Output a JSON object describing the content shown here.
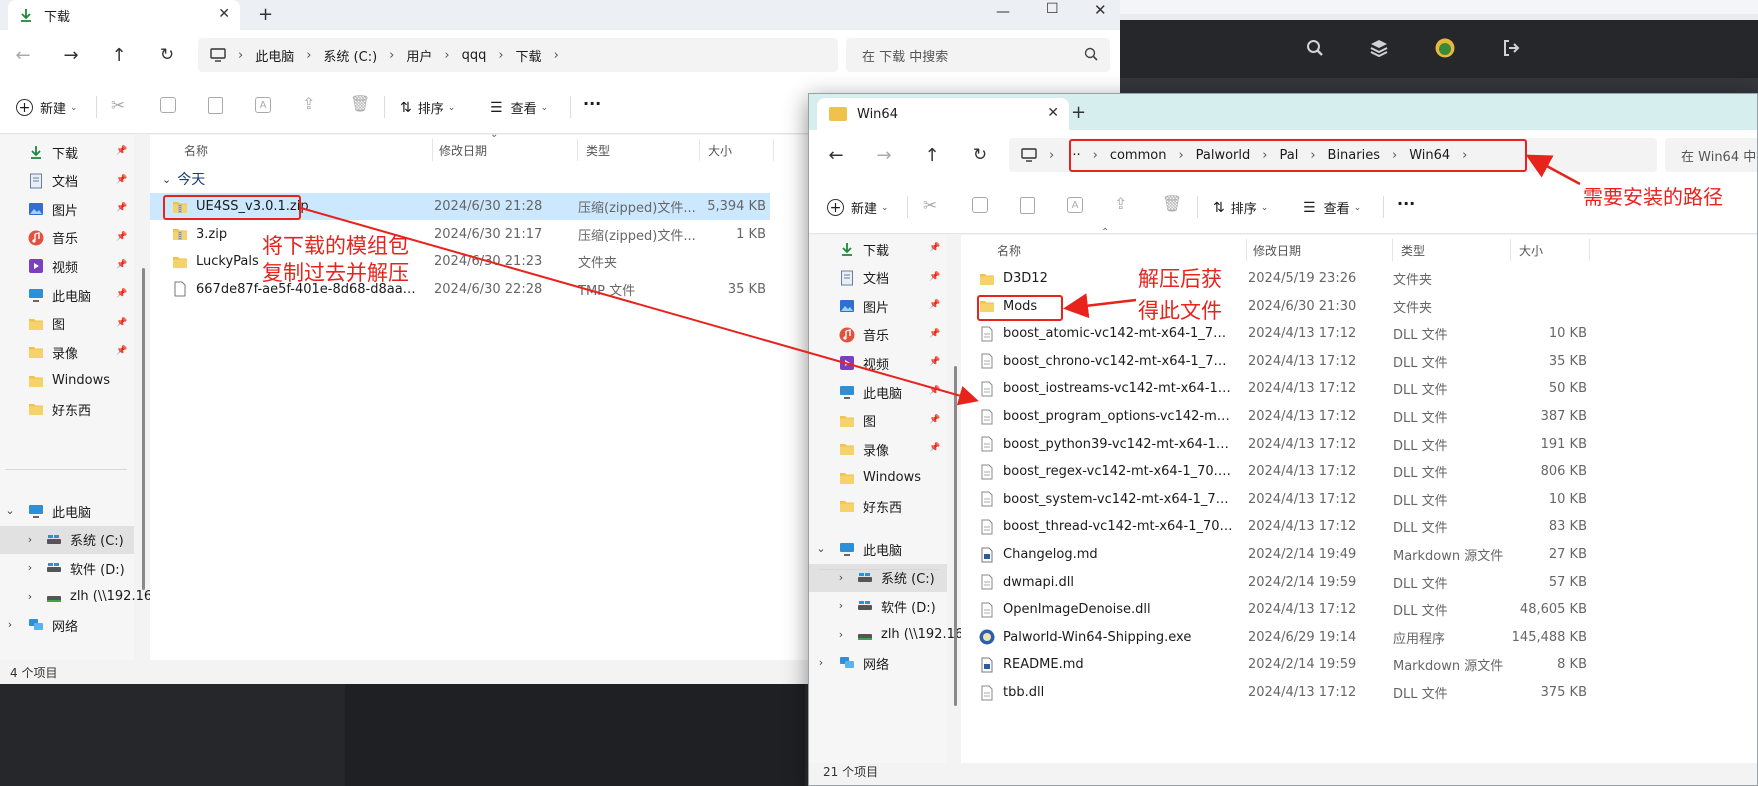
{
  "colors": {
    "accent": "#0067c0",
    "annotation": "#e8231c",
    "folder": "#f0c14b",
    "selected": "#cce8ff"
  },
  "background_app": {
    "icons": [
      "search-icon",
      "layers-icon",
      "avatar-icon",
      "logout-icon"
    ]
  },
  "left_window": {
    "tab_title": "下载",
    "add_tab": "+",
    "breadcrumb": [
      "此电脑",
      "系统 (C:)",
      "用户",
      "qqq",
      "下载"
    ],
    "search_placeholder": "在 下载 中搜索",
    "toolbar": {
      "new": "新建",
      "sort": "排序",
      "view": "查看",
      "more": "···"
    },
    "nav_quick": [
      {
        "label": "下载",
        "icon": "download-icon"
      },
      {
        "label": "文档",
        "icon": "document-icon"
      },
      {
        "label": "图片",
        "icon": "picture-icon"
      },
      {
        "label": "音乐",
        "icon": "music-icon"
      },
      {
        "label": "视频",
        "icon": "video-icon"
      },
      {
        "label": "此电脑",
        "icon": "computer-icon"
      },
      {
        "label": "图",
        "icon": "folder-icon"
      },
      {
        "label": "录像",
        "icon": "folder-icon"
      },
      {
        "label": "Windows",
        "icon": "folder-icon"
      },
      {
        "label": "好东西",
        "icon": "folder-icon"
      }
    ],
    "nav_tree": [
      {
        "label": "此电脑",
        "icon": "computer-icon",
        "chevron": "expanded"
      },
      {
        "label": "系统 (C:)",
        "icon": "drive-icon",
        "chevron": "collapsed"
      },
      {
        "label": "软件 (D:)",
        "icon": "drive-icon",
        "chevron": "collapsed"
      },
      {
        "label": "zlh (\\\\192.168",
        "icon": "network-drive-icon",
        "chevron": "collapsed"
      },
      {
        "label": "网络",
        "icon": "network-icon",
        "chevron": "collapsed"
      }
    ],
    "columns": {
      "name": "名称",
      "date": "修改日期",
      "type": "类型",
      "size": "大小"
    },
    "group_label": "今天",
    "files": [
      {
        "name": "UE4SS_v3.0.1.zip",
        "date": "2024/6/30 21:28",
        "type": "压缩(zipped)文件...",
        "size": "5,394 KB",
        "icon": "zip-icon"
      },
      {
        "name": "3.zip",
        "date": "2024/6/30 21:17",
        "type": "压缩(zipped)文件...",
        "size": "1 KB",
        "icon": "zip-icon"
      },
      {
        "name": "LuckyPals",
        "date": "2024/6/30 21:23",
        "type": "文件夹",
        "size": "",
        "icon": "folder-icon"
      },
      {
        "name": "667de87f-ae5f-401e-8d68-d8aa2bc3...",
        "date": "2024/6/30 22:28",
        "type": "TMP 文件",
        "size": "35 KB",
        "icon": "file-icon"
      }
    ],
    "status": "4 个项目"
  },
  "right_window": {
    "tab_title": "Win64",
    "add_tab": "+",
    "breadcrumb": [
      "···",
      "common",
      "Palworld",
      "Pal",
      "Binaries",
      "Win64"
    ],
    "search_placeholder": "在 Win64 中搜",
    "toolbar": {
      "new": "新建",
      "sort": "排序",
      "view": "查看",
      "more": "···"
    },
    "nav_quick": [
      {
        "label": "下载",
        "icon": "download-icon"
      },
      {
        "label": "文档",
        "icon": "document-icon"
      },
      {
        "label": "图片",
        "icon": "picture-icon"
      },
      {
        "label": "音乐",
        "icon": "music-icon"
      },
      {
        "label": "视频",
        "icon": "video-icon"
      },
      {
        "label": "此电脑",
        "icon": "computer-icon"
      },
      {
        "label": "图",
        "icon": "folder-icon"
      },
      {
        "label": "录像",
        "icon": "folder-icon"
      },
      {
        "label": "Windows",
        "icon": "folder-icon"
      },
      {
        "label": "好东西",
        "icon": "folder-icon"
      }
    ],
    "nav_tree": [
      {
        "label": "此电脑",
        "icon": "computer-icon",
        "chevron": "expanded"
      },
      {
        "label": "系统 (C:)",
        "icon": "drive-icon",
        "chevron": "collapsed"
      },
      {
        "label": "软件 (D:)",
        "icon": "drive-icon",
        "chevron": "collapsed"
      },
      {
        "label": "zlh (\\\\192.168",
        "icon": "network-drive-icon",
        "chevron": "collapsed"
      },
      {
        "label": "网络",
        "icon": "network-icon",
        "chevron": "collapsed"
      }
    ],
    "columns": {
      "name": "名称",
      "date": "修改日期",
      "type": "类型",
      "size": "大小"
    },
    "files": [
      {
        "name": "D3D12",
        "date": "2024/5/19 23:26",
        "type": "文件夹",
        "size": "",
        "icon": "folder-icon"
      },
      {
        "name": "Mods",
        "date": "2024/6/30 21:30",
        "type": "文件夹",
        "size": "",
        "icon": "folder-icon"
      },
      {
        "name": "boost_atomic-vc142-mt-x64-1_70.dll",
        "date": "2024/4/13 17:12",
        "type": "DLL 文件",
        "size": "10 KB",
        "icon": "dll-icon"
      },
      {
        "name": "boost_chrono-vc142-mt-x64-1_70.dll",
        "date": "2024/4/13 17:12",
        "type": "DLL 文件",
        "size": "35 KB",
        "icon": "dll-icon"
      },
      {
        "name": "boost_iostreams-vc142-mt-x64-1_70....",
        "date": "2024/4/13 17:12",
        "type": "DLL 文件",
        "size": "50 KB",
        "icon": "dll-icon"
      },
      {
        "name": "boost_program_options-vc142-mt-x6...",
        "date": "2024/4/13 17:12",
        "type": "DLL 文件",
        "size": "387 KB",
        "icon": "dll-icon"
      },
      {
        "name": "boost_python39-vc142-mt-x64-1_70.dll",
        "date": "2024/4/13 17:12",
        "type": "DLL 文件",
        "size": "191 KB",
        "icon": "dll-icon"
      },
      {
        "name": "boost_regex-vc142-mt-x64-1_70.dll",
        "date": "2024/4/13 17:12",
        "type": "DLL 文件",
        "size": "806 KB",
        "icon": "dll-icon"
      },
      {
        "name": "boost_system-vc142-mt-x64-1_70.dll",
        "date": "2024/4/13 17:12",
        "type": "DLL 文件",
        "size": "10 KB",
        "icon": "dll-icon"
      },
      {
        "name": "boost_thread-vc142-mt-x64-1_70.dll",
        "date": "2024/4/13 17:12",
        "type": "DLL 文件",
        "size": "83 KB",
        "icon": "dll-icon"
      },
      {
        "name": "Changelog.md",
        "date": "2024/2/14 19:49",
        "type": "Markdown 源文件",
        "size": "27 KB",
        "icon": "markdown-icon"
      },
      {
        "name": "dwmapi.dll",
        "date": "2024/2/14 19:59",
        "type": "DLL 文件",
        "size": "57 KB",
        "icon": "dll-icon"
      },
      {
        "name": "OpenImageDenoise.dll",
        "date": "2024/4/13 17:12",
        "type": "DLL 文件",
        "size": "48,605 KB",
        "icon": "dll-icon"
      },
      {
        "name": "Palworld-Win64-Shipping.exe",
        "date": "2024/6/29 19:14",
        "type": "应用程序",
        "size": "145,488 KB",
        "icon": "exe-icon"
      },
      {
        "name": "README.md",
        "date": "2024/2/14 19:59",
        "type": "Markdown 源文件",
        "size": "8 KB",
        "icon": "markdown-icon"
      },
      {
        "name": "tbb.dll",
        "date": "2024/4/13 17:12",
        "type": "DLL 文件",
        "size": "375 KB",
        "icon": "dll-icon"
      }
    ],
    "status": "21 个项目"
  },
  "annotations": {
    "copy_note_line1": "将下载的模组包",
    "copy_note_line2": "复制过去并解压",
    "extract_note_line1": "解压后获",
    "extract_note_line2": "得此文件",
    "path_note": "需要安装的路径"
  }
}
